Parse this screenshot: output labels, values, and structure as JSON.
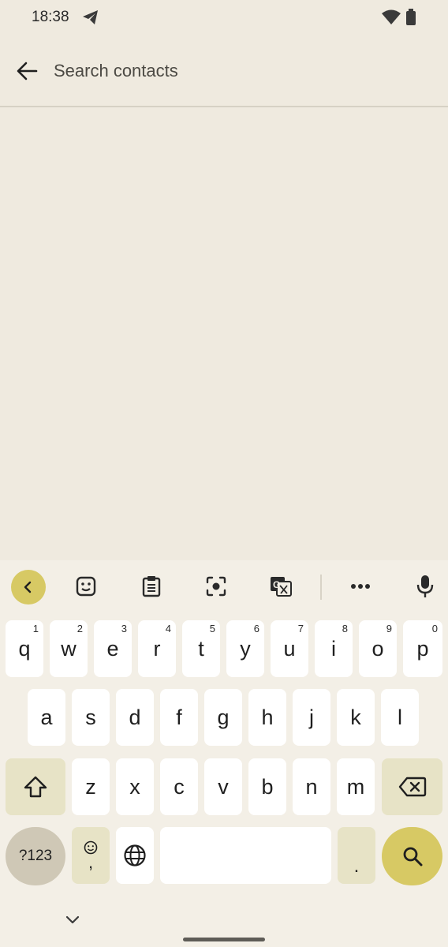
{
  "status_bar": {
    "time": "18:38",
    "icons": [
      "telegram-icon",
      "wifi-icon",
      "battery-icon"
    ]
  },
  "search": {
    "placeholder": "Search contacts",
    "value": ""
  },
  "keyboard": {
    "toolbar": [
      "collapse-toolbar-icon",
      "sticker-icon",
      "clipboard-icon",
      "lens-icon",
      "translate-icon",
      "more-icon",
      "mic-icon"
    ],
    "row1": [
      {
        "label": "q",
        "hint": "1"
      },
      {
        "label": "w",
        "hint": "2"
      },
      {
        "label": "e",
        "hint": "3"
      },
      {
        "label": "r",
        "hint": "4"
      },
      {
        "label": "t",
        "hint": "5"
      },
      {
        "label": "y",
        "hint": "6"
      },
      {
        "label": "u",
        "hint": "7"
      },
      {
        "label": "i",
        "hint": "8"
      },
      {
        "label": "o",
        "hint": "9"
      },
      {
        "label": "p",
        "hint": "0"
      }
    ],
    "row2": [
      "a",
      "s",
      "d",
      "f",
      "g",
      "h",
      "j",
      "k",
      "l"
    ],
    "row3": [
      "z",
      "x",
      "c",
      "v",
      "b",
      "n",
      "m"
    ],
    "symbols_label": "?123",
    "comma_label": ",",
    "period_label": ".",
    "space_label": ""
  },
  "colors": {
    "background": "#efeadf",
    "accent": "#d7c964",
    "special_key": "#e7e3c6"
  }
}
